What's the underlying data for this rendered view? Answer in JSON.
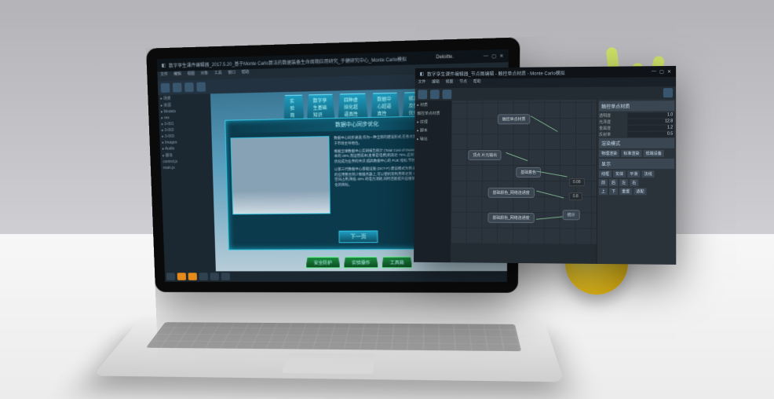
{
  "scene": {
    "object": "laptop-on-desk",
    "props": [
      "lemon",
      "plant"
    ]
  },
  "left_window": {
    "brand": "Deloitte.",
    "title": "数字孪生课件编辑器_2017.5.20_基于Monte Carlo算法的数据装备生命周期应用研究_于健研究中心_Monte Carlo模拟",
    "menu": [
      "文件",
      "编辑",
      "视图",
      "对象",
      "工具",
      "窗口",
      "帮助"
    ],
    "side_tree": [
      "▸ 场景",
      "▸ 资源",
      "  ▸ Models",
      "  ▸ res",
      "    ▸ 3-001",
      "    ▸ 3-002",
      "    ▸ 3-003",
      "  ▸ Images",
      "  ▸ Audio",
      "▸ 脚本",
      "  control.js",
      "  main.js"
    ],
    "hud_tabs": [
      "实验简介",
      "数字孪生基础知识",
      "四种虚拟化超逼真性",
      "数据中心超逼真性",
      "碳减排及整体优化"
    ],
    "popup": {
      "title": "数据中心同步优化",
      "paragraphs": [
        "数据中心同步通道,作为一种全新的建设形式,在各大领域受到广泛采用,特别市场占比远高综合都居于市场主导地位。",
        "根据全球数据中心实研报告统计 (Total Cost of Ownership, 简称TCO),数据中心的建设成本约占总成本的 25%,而运营成本(主要是电费)则高达 75%,这对于企业的可持续发展是极大的压力。因此能耗优化成为业界的共识,提高数据中心的 PUE 指标,节约碳排放,响应国家碳中和政策。",
        "以第三代数据中心基础设施 (DCT-P) 建设模式为例:通过虚拟化技术把原本运行在多台物理服务器上的应用整合到少数服务器上,可以使机架利用率达到 70% 以上,减少 50% 的物理机数量,节约 60% 的空间占用,降低 40% 的电力消耗,同时还能提升运维效率,降低人力成本,进一步实现数据中心同步优化的目标。"
      ],
      "button": "下一页"
    },
    "bottom_tabs": [
      "安全防护",
      "实验操作",
      "工具箱"
    ]
  },
  "right_window": {
    "title": "数字孪生课件编辑器_节点图编辑 - 触控单点材质 - Monte Carlo模拟",
    "menu": [
      "文件",
      "编辑",
      "视图",
      "节点",
      "帮助"
    ],
    "side_tree": [
      "▸ 材质",
      "  触控单点材质",
      "▸ 纹理",
      "▸ 脚本",
      "▸ 输出"
    ],
    "nodes": {
      "n1": "触控单点材质",
      "n2": "顶点  片元输出",
      "n3": "基础着色",
      "n4": "基础颜色_网络连通度",
      "n5": "基础颜色_网络连通度",
      "n6": "统计",
      "num_a": "0.08",
      "num_b": "0.8"
    },
    "inspector": {
      "title": "触控单点材质",
      "rows": [
        {
          "label": "透明度",
          "value": "1.0"
        },
        {
          "label": "光泽度",
          "value": "12.8"
        },
        {
          "label": "金属度",
          "value": "1.2"
        },
        {
          "label": "反射率",
          "value": "0.5"
        }
      ],
      "section2_title": "渲染模式",
      "buttons_row1": [
        "物理渲染",
        "标准渲染",
        "低端设备"
      ],
      "section3_title": "显示",
      "buttons_row2": [
        "线框",
        "实体",
        "平滑",
        "法线"
      ],
      "buttons_row3": [
        "前",
        "后",
        "左",
        "右"
      ],
      "buttons_row4": [
        "上",
        "下",
        "重置",
        "适配"
      ]
    }
  }
}
